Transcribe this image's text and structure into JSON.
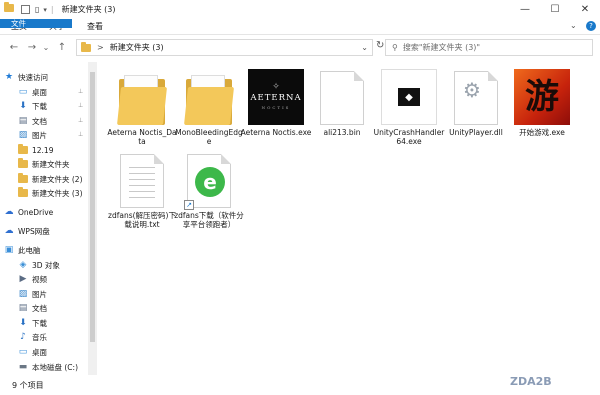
{
  "window": {
    "title": "新建文件夹 (3)",
    "min": "—",
    "max": "☐",
    "close": "✕"
  },
  "ribbon": {
    "tabs": [
      {
        "label": "文件"
      },
      {
        "label": "主页"
      },
      {
        "label": "共享"
      },
      {
        "label": "查看"
      }
    ],
    "expand": "⌄",
    "help": "?"
  },
  "address": {
    "back": "←",
    "forward": "→",
    "recent": "⌄",
    "up": "↑",
    "separator": ">",
    "path": "新建文件夹 (3)",
    "dropdown": "⌄",
    "refresh": "↻",
    "search_placeholder": "搜索\"新建文件夹 (3)\""
  },
  "nav": {
    "items": [
      {
        "label": "快速访问",
        "icon": "star-icon",
        "pinned": false
      },
      {
        "label": "桌面",
        "icon": "desktop-icon",
        "pinned": true
      },
      {
        "label": "下载",
        "icon": "download-icon",
        "pinned": true
      },
      {
        "label": "文档",
        "icon": "document-icon",
        "pinned": true
      },
      {
        "label": "图片",
        "icon": "picture-icon",
        "pinned": true
      },
      {
        "label": "12.19",
        "icon": "folder-icon",
        "pinned": false
      },
      {
        "label": "新建文件夹",
        "icon": "folder-icon",
        "pinned": false
      },
      {
        "label": "新建文件夹 (2)",
        "icon": "folder-icon",
        "pinned": false
      },
      {
        "label": "新建文件夹 (3)",
        "icon": "folder-icon",
        "pinned": false
      },
      {
        "label": "OneDrive",
        "icon": "cloud-icon",
        "pinned": false
      },
      {
        "label": "WPS网盘",
        "icon": "cloud-icon",
        "pinned": false
      },
      {
        "label": "此电脑",
        "icon": "computer-icon",
        "pinned": false
      },
      {
        "label": "3D 对象",
        "icon": "3d-objects-icon",
        "pinned": false
      },
      {
        "label": "视频",
        "icon": "video-icon",
        "pinned": false
      },
      {
        "label": "图片",
        "icon": "picture-icon",
        "pinned": false
      },
      {
        "label": "文档",
        "icon": "document-icon",
        "pinned": false
      },
      {
        "label": "下载",
        "icon": "download-icon",
        "pinned": false
      },
      {
        "label": "音乐",
        "icon": "music-icon",
        "pinned": false
      },
      {
        "label": "桌面",
        "icon": "desktop-icon",
        "pinned": false
      },
      {
        "label": "本地磁盘 (C:)",
        "icon": "drive-icon",
        "pinned": false
      }
    ],
    "pin_glyph": "📌"
  },
  "files": [
    {
      "name": "Aeterna Noctis_Data",
      "type": "folder"
    },
    {
      "name": "MonoBleedingEdge",
      "type": "folder"
    },
    {
      "name": "Aeterna Noctis.exe",
      "type": "exe",
      "logo_text": "AETERNA",
      "logo_sub": "NOCTIS"
    },
    {
      "name": "ali213.bin",
      "type": "bin"
    },
    {
      "name": "UnityCrashHandler64.exe",
      "type": "exe-unity"
    },
    {
      "name": "UnityPlayer.dll",
      "type": "dll"
    },
    {
      "name": "开始游戏.exe",
      "type": "exe-game",
      "logo_text": "游"
    },
    {
      "name": "zdfans(解压密码)下载说明.txt",
      "type": "txt"
    },
    {
      "name": "zdfans下载（软件分享平台领跑者）",
      "type": "url"
    }
  ],
  "status": {
    "count": "9 个项目"
  },
  "watermark": "ZDA2B",
  "colors": {
    "accent": "#1979ca",
    "folder": "#f3c85a"
  }
}
